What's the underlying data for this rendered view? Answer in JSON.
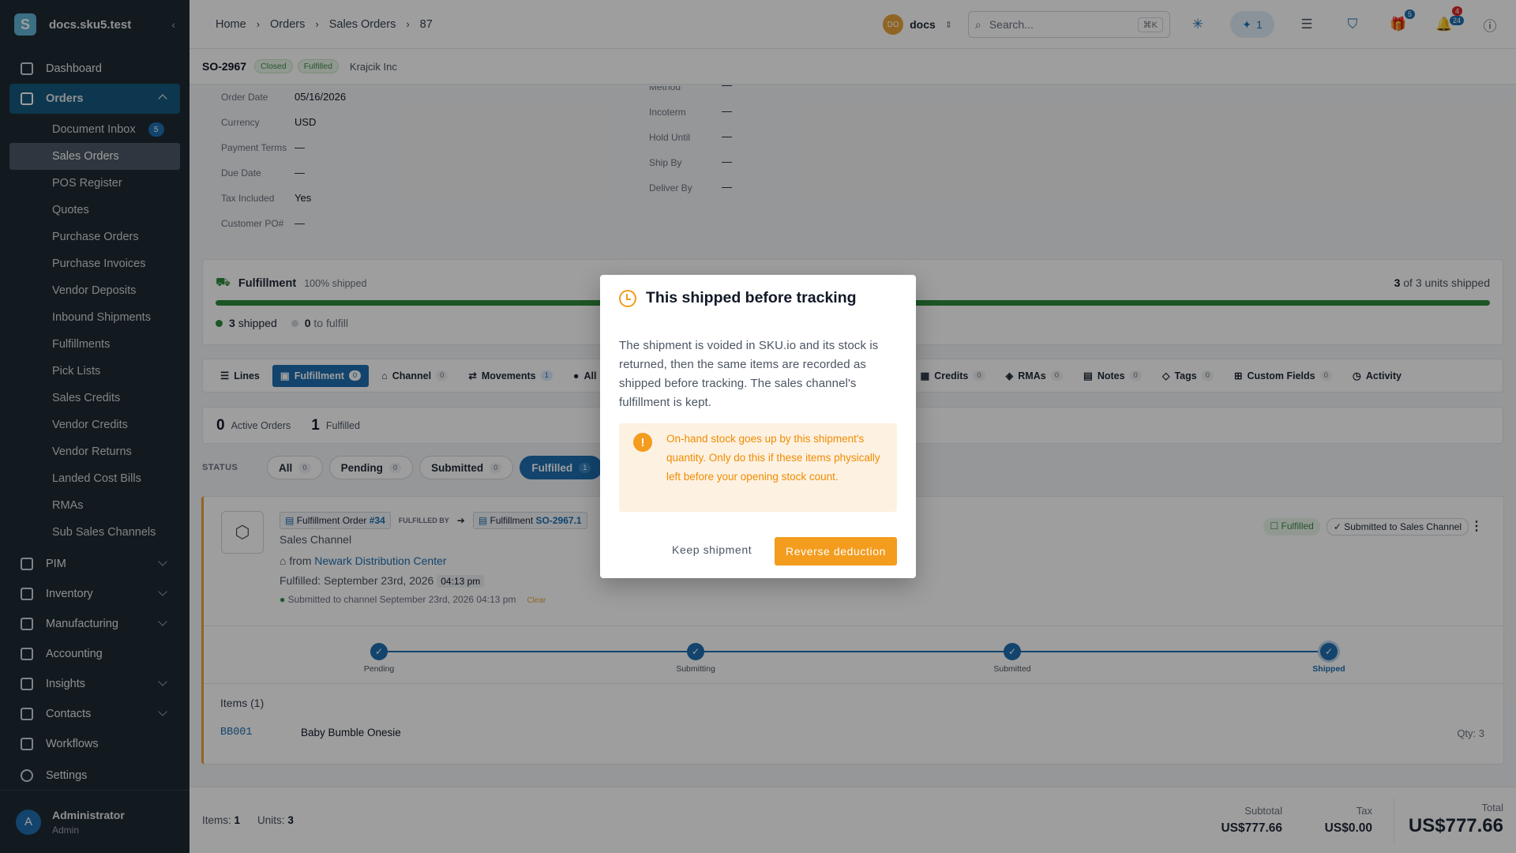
{
  "app": {
    "workspace": "docs.sku5.test"
  },
  "sidebar": {
    "items": [
      {
        "label": "Dashboard"
      },
      {
        "label": "Orders"
      },
      {
        "label": "PIM"
      },
      {
        "label": "Inventory"
      },
      {
        "label": "Manufacturing"
      },
      {
        "label": "Accounting"
      },
      {
        "label": "Insights"
      },
      {
        "label": "Contacts"
      },
      {
        "label": "Workflows"
      },
      {
        "label": "Settings"
      }
    ],
    "orders_sub": [
      {
        "label": "Document Inbox",
        "badge": "5"
      },
      {
        "label": "Sales Orders"
      },
      {
        "label": "POS Register"
      },
      {
        "label": "Quotes"
      },
      {
        "label": "Purchase Orders"
      },
      {
        "label": "Purchase Invoices"
      },
      {
        "label": "Vendor Deposits"
      },
      {
        "label": "Inbound Shipments"
      },
      {
        "label": "Fulfillments"
      },
      {
        "label": "Pick Lists"
      },
      {
        "label": "Sales Credits"
      },
      {
        "label": "Vendor Credits"
      },
      {
        "label": "Vendor Returns"
      },
      {
        "label": "Landed Cost Bills"
      },
      {
        "label": "RMAs"
      },
      {
        "label": "Sub Sales Channels"
      }
    ],
    "user": {
      "initial": "A",
      "name": "Administrator",
      "role": "Admin"
    }
  },
  "breadcrumb": [
    "Home",
    "Orders",
    "Sales Orders",
    "87"
  ],
  "topbar": {
    "org_initials": "DO",
    "org_name": "docs",
    "search_placeholder": "Search...",
    "search_kbd": "⌘K",
    "ai_count": "1",
    "gift_badge": "5",
    "notif_red": "4",
    "notif_blue": "24"
  },
  "order": {
    "number": "SO-2967",
    "status1": "Closed",
    "status2": "Fulfilled",
    "customer": "Krajcik Inc"
  },
  "details_left": [
    {
      "label": "Order Date",
      "value": "05/16/2026"
    },
    {
      "label": "Currency",
      "value": "USD"
    },
    {
      "label": "Payment Terms",
      "value": "—"
    },
    {
      "label": "Due Date",
      "value": "—"
    },
    {
      "label": "Tax Included",
      "value": "Yes"
    },
    {
      "label": "Customer PO#",
      "value": "—"
    }
  ],
  "details_right": [
    {
      "label": "Method",
      "value": "—"
    },
    {
      "label": "Incoterm",
      "value": "—"
    },
    {
      "label": "Hold Until",
      "value": "—"
    },
    {
      "label": "Ship By",
      "value": "—"
    },
    {
      "label": "Deliver By",
      "value": "—"
    }
  ],
  "fulfillment": {
    "title": "Fulfillment",
    "percent_label": "100% shipped",
    "units_shipped": "3",
    "units_of": "of 3 units shipped",
    "shipped_count": "3",
    "shipped_label": "shipped",
    "tofulfill_count": "0",
    "tofulfill_label": "to fulfill",
    "progress": 1.0
  },
  "tabs": [
    {
      "label": "Lines",
      "count": ""
    },
    {
      "label": "Fulfillment",
      "count": "0"
    },
    {
      "label": "Channel",
      "count": "0"
    },
    {
      "label": "Movements",
      "count": "1"
    },
    {
      "label": "All",
      "count": ""
    },
    {
      "label": "Credits",
      "count": "0"
    },
    {
      "label": "RMAs",
      "count": "0"
    },
    {
      "label": "Notes",
      "count": "0"
    },
    {
      "label": "Tags",
      "count": "0"
    },
    {
      "label": "Custom Fields",
      "count": "0"
    },
    {
      "label": "Activity",
      "count": ""
    }
  ],
  "summary": {
    "active_count": "0",
    "active_label": "Active Orders",
    "fulfilled_count": "1",
    "fulfilled_label": "Fulfilled"
  },
  "status_filter": {
    "label": "STATUS",
    "chips": [
      {
        "label": "All",
        "count": "0"
      },
      {
        "label": "Pending",
        "count": "0"
      },
      {
        "label": "Submitted",
        "count": "0"
      },
      {
        "label": "Fulfilled",
        "count": "1"
      }
    ]
  },
  "fulfillment_order": {
    "fo_label": "Fulfillment Order",
    "fo_num": "#34",
    "fulfilled_by": "FULFILLED BY",
    "ful_label": "Fulfillment",
    "ful_num": "SO-2967.1",
    "channel": "Sales Channel",
    "from": "from",
    "warehouse": "Newark Distribution Center",
    "fulfilled_date": "Fulfilled: September 23rd, 2026",
    "fulfilled_time": "04:13 pm",
    "submitted_text": "Submitted to channel September 23rd, 2026 04:13 pm",
    "clear": "Clear",
    "badge_fulfilled": "Fulfilled",
    "badge_submitted": "Submitted to Sales Channel",
    "steps": [
      "Pending",
      "Submitting",
      "Submitted",
      "Shipped"
    ],
    "items_title": "Items (1)",
    "item_sku": "BB001",
    "item_name": "Baby Bumble Onesie",
    "item_qty": "Qty: 3"
  },
  "footer": {
    "items_label": "Items:",
    "items": "1",
    "units_label": "Units:",
    "units": "3",
    "subtotal_label": "Subtotal",
    "subtotal": "US$777.66",
    "tax_label": "Tax",
    "tax": "US$0.00",
    "total_label": "Total",
    "total": "US$777.66"
  },
  "modal": {
    "title": "This shipped before tracking",
    "body": "The shipment is voided in SKU.io and its stock is returned, then the same items are recorded as shipped before tracking. The sales channel's fulfillment is kept.",
    "warning": "On-hand stock goes up by this shipment's quantity. Only do this if these items physically left before your opening stock count.",
    "keep": "Keep shipment",
    "reverse": "Reverse deduction"
  },
  "colors": {
    "accent": "#1d6fb0",
    "warning": "#f39c1e",
    "success": "#2e8b3d",
    "sidebar": "#1e2a33"
  }
}
